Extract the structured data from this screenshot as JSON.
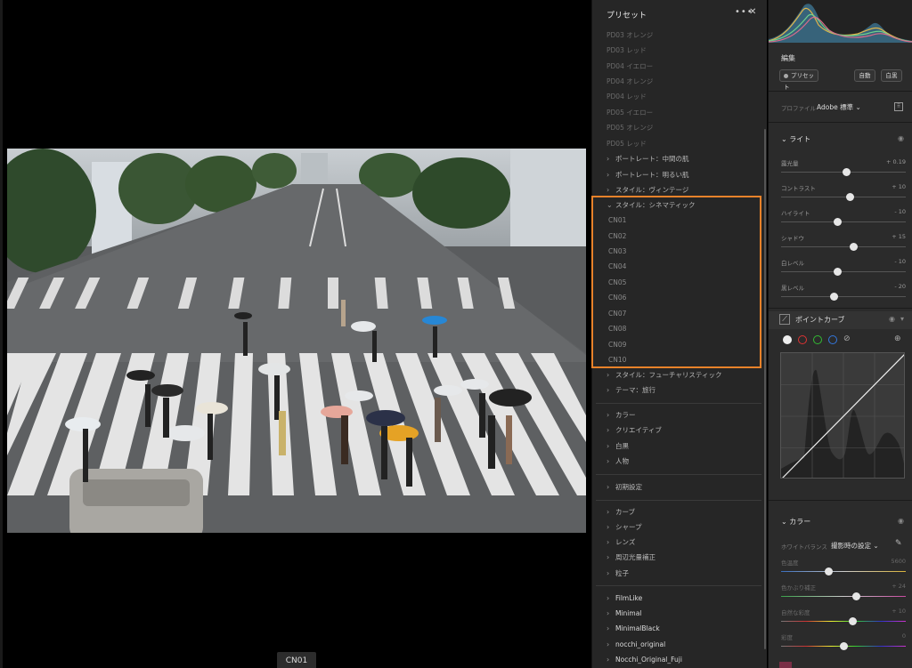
{
  "filmstrip": {
    "label": "CN01"
  },
  "presets": {
    "title": "プリセット",
    "more": "•••",
    "close": "✕",
    "dim_items": [
      "PD03 オレンジ",
      "PD03 レッド",
      "PD04 イエロー",
      "PD04 オレンジ",
      "PD04 レッド",
      "PD05 イエロー",
      "PD05 オレンジ",
      "PD05 レッド"
    ],
    "groups_top": [
      "ポートレート：中間の肌",
      "ポートレート：明るい肌",
      "スタイル：ヴィンテージ"
    ],
    "open_group": "スタイル：シネマティック",
    "open_items": [
      "CN01",
      "CN02",
      "CN03",
      "CN04",
      "CN05",
      "CN06",
      "CN07",
      "CN08",
      "CN09",
      "CN10"
    ],
    "groups_after": [
      "スタイル：フューチャリスティック",
      "テーマ：旅行"
    ],
    "groups_b": [
      "カラー",
      "クリエイティブ",
      "白黒",
      "人物"
    ],
    "groups_c": [
      "初期設定"
    ],
    "groups_d": [
      "カーブ",
      "シャープ",
      "レンズ",
      "周辺光量補正",
      "粒子"
    ],
    "groups_e": [
      "FilmLike",
      "Minimal",
      "MinimalBlack",
      "nocchi_original",
      "Nocchi_Original_Fuji"
    ]
  },
  "edit": {
    "title": "編集",
    "preset_btn": "プリセット",
    "auto_btn": "自動",
    "bw_btn": "白黒",
    "profile_label": "プロファイル",
    "profile_value": "Adobe 標準",
    "light": {
      "title": "ライト",
      "sliders": [
        {
          "name": "露光量",
          "value": "+ 0.19",
          "pos": 0.52
        },
        {
          "name": "コントラスト",
          "value": "+ 10",
          "pos": 0.55
        },
        {
          "name": "ハイライト",
          "value": "- 10",
          "pos": 0.45
        },
        {
          "name": "シャドウ",
          "value": "+ 15",
          "pos": 0.58
        },
        {
          "name": "白レベル",
          "value": "- 10",
          "pos": 0.45
        },
        {
          "name": "黒レベル",
          "value": "- 20",
          "pos": 0.42
        }
      ]
    },
    "curve": {
      "title": "ポイントカーブ"
    },
    "color": {
      "title": "カラー",
      "wb_label": "ホワイトバランス",
      "wb_value": "撮影時の設定",
      "sliders": [
        {
          "name": "色温度",
          "value": "5600",
          "pos": 0.38
        },
        {
          "name": "色かぶり補正",
          "value": "+ 24",
          "pos": 0.6
        },
        {
          "name": "自然な彩度",
          "value": "+ 10",
          "pos": 0.57
        },
        {
          "name": "彩度",
          "value": "0",
          "pos": 0.5
        }
      ]
    }
  }
}
